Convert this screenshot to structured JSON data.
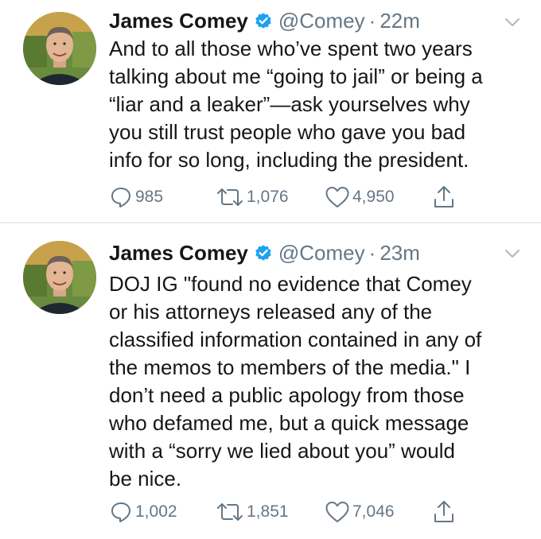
{
  "tweets": [
    {
      "author": {
        "name": "James Comey",
        "handle": "@Comey",
        "separator": "·",
        "time": "22m"
      },
      "lines": [
        "And to all those who’ve spent two years",
        "talking about me “going to jail” or being a",
        "“liar and a leaker”—ask yourselves why",
        "you still trust people who gave you bad",
        "info for so long, including the president."
      ],
      "replies": "985",
      "retweets": "1,076",
      "likes": "4,950"
    },
    {
      "author": {
        "name": "James Comey",
        "handle": "@Comey",
        "separator": "·",
        "time": "23m"
      },
      "lines": [
        "DOJ IG \"found no evidence that Comey",
        "or his attorneys released any of the",
        "classified information contained in any of",
        "the memos to members of the media.\" I",
        "don’t need a public apology from those",
        "who defamed me, but a quick message",
        "with a “sorry we lied about you” would",
        "be nice."
      ],
      "replies": "1,002",
      "retweets": "1,851",
      "likes": "7,046"
    }
  ],
  "icons": {
    "verified": "verified-badge-icon",
    "caret": "chevron-down-icon",
    "reply": "reply-icon",
    "retweet": "retweet-icon",
    "like": "heart-icon",
    "share": "share-icon"
  },
  "colors": {
    "verified_blue": "#1da1f2",
    "text": "#14171a",
    "secondary": "#657786",
    "divider": "#e6ecf0"
  }
}
